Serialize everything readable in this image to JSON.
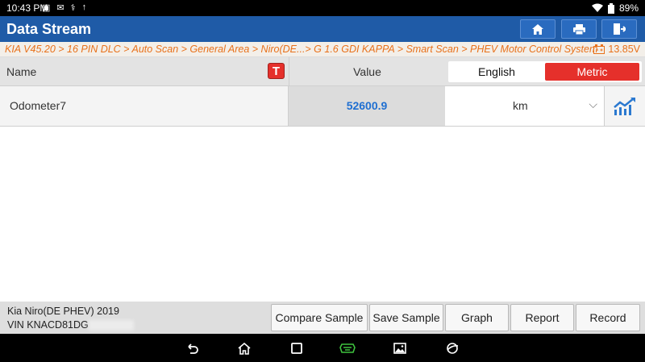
{
  "statusbar": {
    "time": "10:43 PM",
    "battery": "89%"
  },
  "app": {
    "title": "Data Stream"
  },
  "breadcrumb": {
    "path": "KIA V45.20 > 16 PIN DLC > Auto Scan > General Area > Niro(DE...> G 1.6 GDI KAPPA > Smart Scan > PHEV Motor Control System",
    "voltage": "13.85V"
  },
  "header": {
    "name": "Name",
    "value": "Value",
    "english": "English",
    "metric": "Metric",
    "t_label": "T"
  },
  "rows": [
    {
      "name": "Odometer7",
      "value": "52600.9",
      "unit": "km"
    }
  ],
  "footer": {
    "vehicle": "Kia Niro(DE PHEV) 2019",
    "vin": "VIN KNACD81DG",
    "buttons": {
      "compare": "Compare Sample",
      "save": "Save Sample",
      "graph": "Graph",
      "report": "Report",
      "record": "Record"
    }
  },
  "colors": {
    "titlebar": "#1f5ba7",
    "accent_red": "#e5302b",
    "crumb_text": "#e8711b",
    "value_blue": "#1f6fd1"
  }
}
